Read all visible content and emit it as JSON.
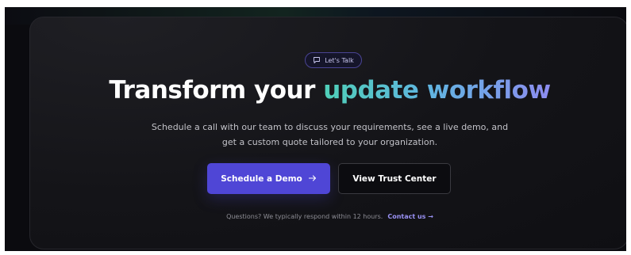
{
  "badge": {
    "icon": "chat-bubble-icon",
    "label": "Let's Talk"
  },
  "headline": {
    "plain": "Transform your ",
    "accent": "update workflow",
    "accent_colors": [
      "#4fd0b8",
      "#5fb6e0",
      "#8d8cf0"
    ]
  },
  "subtext": {
    "line1": "Schedule a call with our team to discuss your requirements, see a live demo, and",
    "line2": "get a custom quote tailored to your organization."
  },
  "buttons": {
    "primary_label": "Schedule a Demo",
    "primary_icon": "arrow-right-icon",
    "primary_color": "#4f46d6",
    "secondary_label": "View Trust Center"
  },
  "footnote": {
    "text": "Questions? We typically respond within 12 hours.",
    "link_label": "Contact us →"
  }
}
